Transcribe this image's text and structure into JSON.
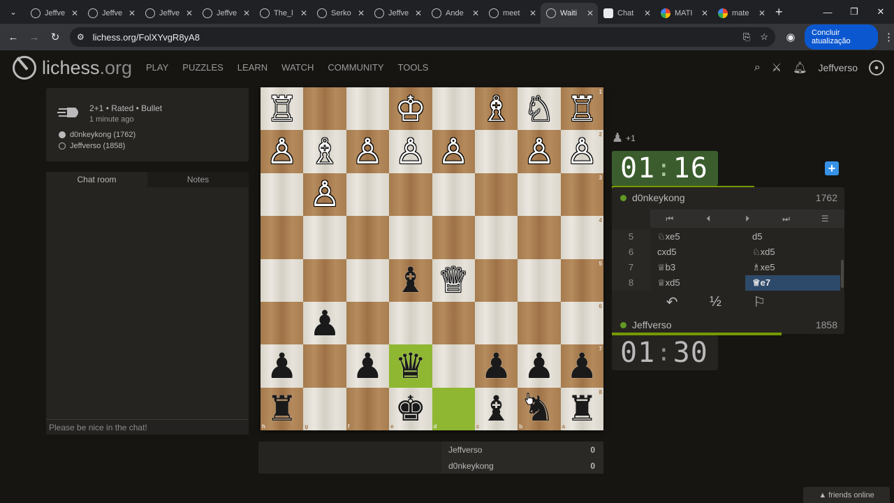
{
  "browser": {
    "tabs": [
      {
        "title": "Jeffve",
        "icon": "lichess-icon",
        "active": false
      },
      {
        "title": "Jeffve",
        "icon": "lichess-icon",
        "active": false
      },
      {
        "title": "Jeffve",
        "icon": "lichess-icon",
        "active": false
      },
      {
        "title": "Jeffve",
        "icon": "lichess-icon",
        "active": false
      },
      {
        "title": "The_l",
        "icon": "lichess-icon",
        "active": false
      },
      {
        "title": "Serko",
        "icon": "lichess-icon",
        "active": false
      },
      {
        "title": "Jeffve",
        "icon": "lichess-icon",
        "active": false
      },
      {
        "title": "Ande",
        "icon": "lichess-icon",
        "active": false
      },
      {
        "title": "meet",
        "icon": "lichess-icon",
        "active": false
      },
      {
        "title": "Waiti",
        "icon": "lichess-icon",
        "active": true
      },
      {
        "title": "Chat",
        "icon": "chatgpt-icon",
        "active": false
      },
      {
        "title": "MATI",
        "icon": "google-icon",
        "active": false
      },
      {
        "title": "mate",
        "icon": "google-icon",
        "active": false
      }
    ],
    "new_tab": "+",
    "url": "lichess.org/FolXYvgR8yA8",
    "update_button": "Concluir atualização"
  },
  "site": {
    "logo_main": "lichess",
    "logo_tld": ".org",
    "nav": [
      "PLAY",
      "PUZZLES",
      "LEARN",
      "WATCH",
      "COMMUNITY",
      "TOOLS"
    ],
    "username": "Jeffverso"
  },
  "game_info": {
    "line1": "2+1 • Rated • Bullet",
    "line2": "1 minute ago",
    "white_player": "d0nkeykong (1762)",
    "black_player": "Jeffverso (1858)"
  },
  "chat": {
    "tab_chat": "Chat room",
    "tab_notes": "Notes",
    "placeholder": "Please be nice in the chat!"
  },
  "board": {
    "orientation": "black",
    "light_color": "#e3ded4",
    "dark_color": "#ab8153",
    "highlight_color": "#9bc43a",
    "rank_labels": [
      "1",
      "2",
      "3",
      "4",
      "5",
      "6",
      "7",
      "8"
    ],
    "file_labels": [
      "h",
      "g",
      "f",
      "e",
      "d",
      "c",
      "b",
      "a"
    ],
    "rows": [
      [
        "wR",
        "",
        "",
        "wK",
        "",
        "wB",
        "wN",
        "wR"
      ],
      [
        "wP",
        "wB",
        "wP",
        "wP",
        "wP",
        "",
        "wP",
        "wP"
      ],
      [
        "",
        "wP",
        "",
        "",
        "",
        "",
        "",
        ""
      ],
      [
        "",
        "",
        "",
        "",
        "",
        "",
        "",
        ""
      ],
      [
        "",
        "",
        "",
        "bB",
        "wQ",
        "",
        "",
        ""
      ],
      [
        "",
        "bP",
        "",
        "",
        "",
        "",
        "",
        ""
      ],
      [
        "bP",
        "",
        "bP",
        "bQ",
        "",
        "bP",
        "bP",
        "bP"
      ],
      [
        "bR",
        "",
        "",
        "bK",
        "",
        "bB",
        "bN",
        "bR"
      ]
    ],
    "highlighted": [
      [
        6,
        3
      ],
      [
        7,
        4
      ]
    ]
  },
  "material": {
    "piece": "♟",
    "diff": "+1"
  },
  "clocks": {
    "top": {
      "min": "01",
      "sec": "16",
      "running": true,
      "bar_fraction": 0.79
    },
    "bottom": {
      "min": "01",
      "sec": "30",
      "running": false,
      "bar_fraction": 0.92
    }
  },
  "players": {
    "top": {
      "name": "d0nkeykong",
      "rating": "1762"
    },
    "bottom": {
      "name": "Jeffverso",
      "rating": "1858"
    }
  },
  "moves": [
    {
      "n": "5",
      "w": "♘xe5",
      "b": "d5"
    },
    {
      "n": "6",
      "w": "cxd5",
      "b": "♘xd5"
    },
    {
      "n": "7",
      "w": "♕b3",
      "b": "♗xe5"
    },
    {
      "n": "8",
      "w": "♕xd5",
      "b": "♕e7"
    }
  ],
  "current_move": "♕e7",
  "actions": {
    "takeback": "↶",
    "draw": "½",
    "resign": "⚐"
  },
  "crosstable": [
    {
      "name": "Jeffverso",
      "score": "0"
    },
    {
      "name": "d0nkeykong",
      "score": "0"
    }
  ],
  "friends": "▲ friends online"
}
